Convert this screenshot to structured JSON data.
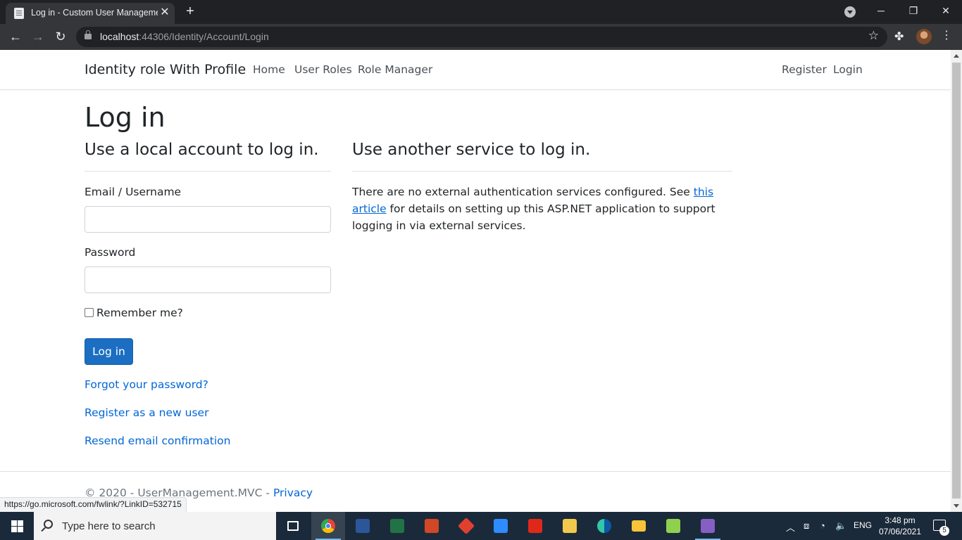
{
  "browser": {
    "tab_title": "Log in - Custom User Manageme",
    "url_host": "localhost",
    "url_rest": ":44306/Identity/Account/Login",
    "status_url": "https://go.microsoft.com/fwlink/?LinkID=532715"
  },
  "navbar": {
    "brand": "Identity role With Profile",
    "links": [
      "Home",
      "User Roles",
      "Role Manager"
    ],
    "right_links": [
      "Register",
      "Login"
    ]
  },
  "page": {
    "title": "Log in",
    "local_heading": "Use a local account to log in.",
    "email_label": "Email / Username",
    "email_value": "",
    "password_label": "Password",
    "password_value": "",
    "remember_label": "Remember me?",
    "remember_checked": false,
    "login_button": "Log in",
    "forgot_link": "Forgot your password?",
    "register_link": "Register as a new user",
    "resend_link": "Resend email confirmation",
    "external_heading": "Use another service to log in.",
    "external_text_before": "There are no external authentication services configured. See ",
    "external_link": "this article",
    "external_text_after": " for details on setting up this ASP.NET application to support logging in via external services."
  },
  "footer": {
    "copyright": "© 2020 - UserManagement.MVC - ",
    "privacy": "Privacy"
  },
  "taskbar": {
    "search_placeholder": "Type here to search",
    "language": "ENG",
    "time": "3:48 pm",
    "date": "07/06/2021",
    "notification_count": "5",
    "apps": [
      "task-view",
      "chrome",
      "word",
      "excel",
      "powerpoint",
      "git",
      "zoom",
      "acrobat",
      "sql-tool",
      "edge",
      "file-explorer",
      "notepad-plus",
      "visual-studio"
    ]
  },
  "colors": {
    "primary_button": "#1b6ec2",
    "link": "#0366d6",
    "chrome_dark": "#202124",
    "taskbar": "#1b2a3a"
  }
}
